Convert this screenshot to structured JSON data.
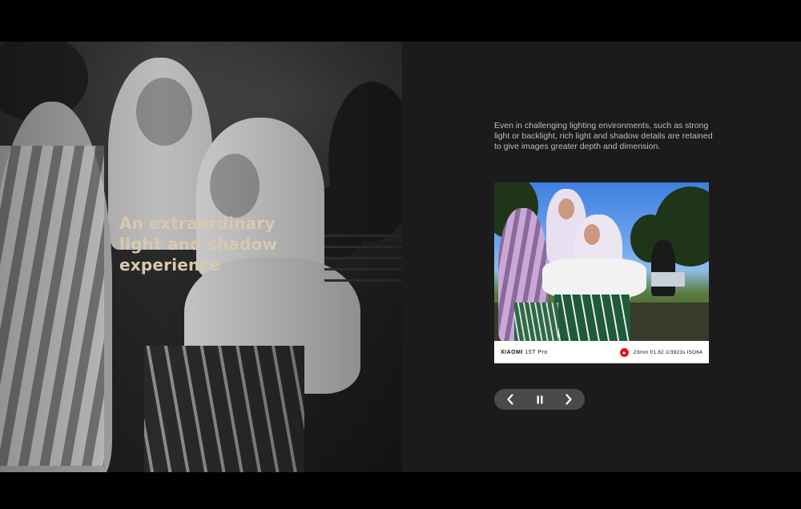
{
  "hero": {
    "headline_line1": "An extraordinary",
    "headline_line2": "light and shadow",
    "headline_line3": "experience",
    "headline_color": "#d9c7b0"
  },
  "description": "Even in challenging lighting environments, such as strong light or backlight, rich light and shadow details are retained to give images greater depth and dimension.",
  "sample_card": {
    "brand": "XIAOMI",
    "model": "15T Pro",
    "lens_badge_icon": "leica-red-dot-icon",
    "exif": {
      "focal_length": "23mm",
      "aperture": "f/1.62",
      "shutter": "1/3923s",
      "iso": "ISO64"
    }
  },
  "controls": {
    "prev_icon": "chevron-left-icon",
    "pause_icon": "pause-icon",
    "next_icon": "chevron-right-icon"
  },
  "colors": {
    "background": "#000000",
    "panel": "#1b1b1b",
    "control_bg": "#4a4a4a",
    "leica_red": "#e0161b"
  }
}
